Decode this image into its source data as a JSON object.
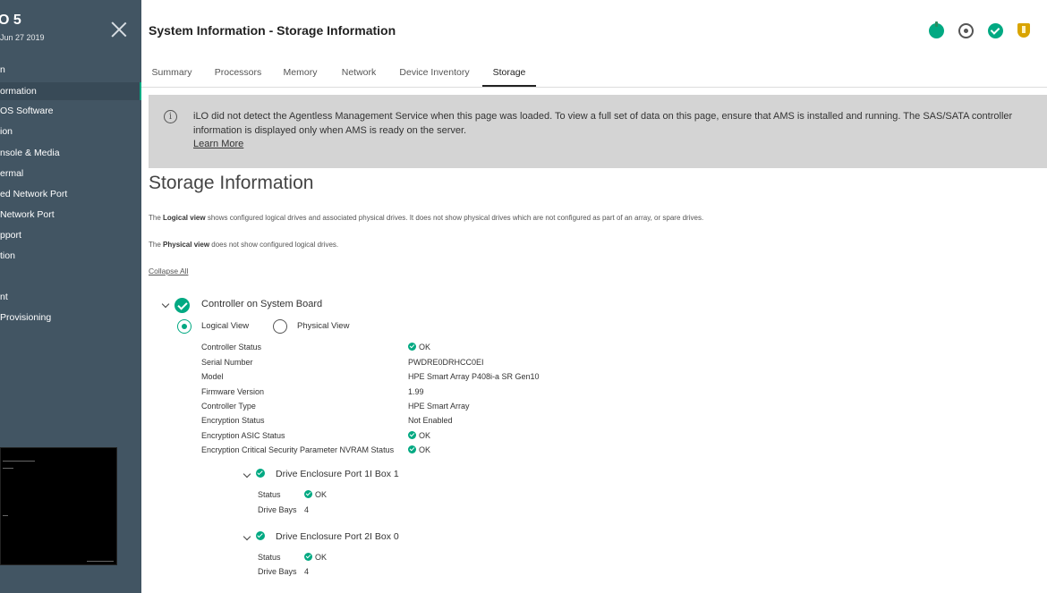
{
  "sidebar": {
    "title": "O 5",
    "subtitle": "Jun 27 2019",
    "items": [
      {
        "label": "n"
      },
      {
        "label": "ormation"
      },
      {
        "label": "OS Software"
      },
      {
        "label": "ion"
      },
      {
        "label": "nsole & Media"
      },
      {
        "label": "ermal"
      },
      {
        "label": "ed Network Port"
      },
      {
        "label": "Network Port"
      },
      {
        "label": "pport"
      },
      {
        "label": "tion"
      },
      {
        "label": ""
      },
      {
        "label": "nt"
      },
      {
        "label": "Provisioning"
      }
    ]
  },
  "header": {
    "title": "System Information - Storage Information",
    "icons": [
      "power-icon",
      "uid-locator-icon",
      "health-ok-icon",
      "security-shield-icon"
    ]
  },
  "tabs": [
    {
      "label": "Summary"
    },
    {
      "label": "Processors"
    },
    {
      "label": "Memory"
    },
    {
      "label": "Network"
    },
    {
      "label": "Device Inventory"
    },
    {
      "label": "Storage",
      "active": true
    }
  ],
  "banner": {
    "text": "iLO did not detect the Agentless Management Service when this page was loaded. To view a full set of data on this page, ensure that AMS is installed and running. The SAS/SATA controller information is displayed only when AMS is ready on the server.",
    "link": "Learn More"
  },
  "main": {
    "title": "Storage Information",
    "logical_desc_bold": "Logical view",
    "logical_desc_pre": "The ",
    "logical_desc_rest": " shows configured logical drives and associated physical drives. It does not show physical drives which are not configured as part of an array, or spare drives.",
    "physical_desc_pre": "The ",
    "physical_desc_bold": "Physical view",
    "physical_desc_rest": " does not show configured logical drives.",
    "collapse_all": "Collapse All"
  },
  "controller": {
    "title": "Controller on System Board",
    "view_logical": "Logical View",
    "view_physical": "Physical View",
    "selected_view": "Logical View",
    "properties": [
      {
        "label": "Controller Status",
        "value": "OK",
        "ok": true
      },
      {
        "label": "Serial Number",
        "value": "PWDRE0DRHCC0EI",
        "ok": false
      },
      {
        "label": "Model",
        "value": "HPE Smart Array P408i-a SR Gen10",
        "ok": false
      },
      {
        "label": "Firmware Version",
        "value": "1.99",
        "ok": false
      },
      {
        "label": "Controller Type",
        "value": "HPE Smart Array",
        "ok": false
      },
      {
        "label": "Encryption Status",
        "value": "Not Enabled",
        "ok": false
      },
      {
        "label": "Encryption ASIC Status",
        "value": "OK",
        "ok": true
      },
      {
        "label": "Encryption Critical Security Parameter NVRAM Status",
        "value": "OK",
        "ok": true
      }
    ]
  },
  "enclosures": [
    {
      "title": "Drive Enclosure Port 1I Box 1",
      "status_label": "Status",
      "status": "OK",
      "bays_label": "Drive Bays",
      "bays": "4"
    },
    {
      "title": "Drive Enclosure Port 2I Box 0",
      "status_label": "Status",
      "status": "OK",
      "bays_label": "Drive Bays",
      "bays": "4"
    }
  ],
  "colors": {
    "sidebar": "#425563",
    "accent": "#01a982",
    "banner": "#d4d4d4"
  }
}
